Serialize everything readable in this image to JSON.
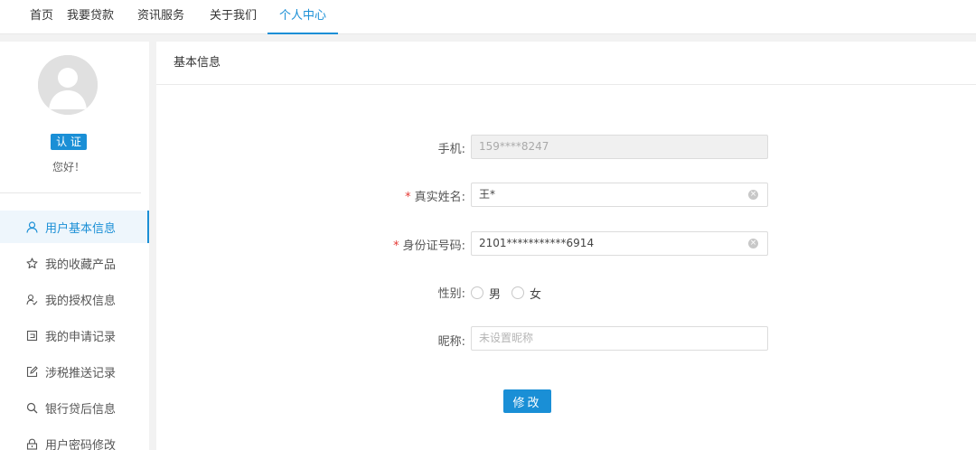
{
  "nav": {
    "items": [
      "首页",
      "我要贷款",
      "资讯服务",
      "关于我们",
      "个人中心"
    ],
    "active_index": 4
  },
  "sidebar": {
    "badge": "认 证",
    "greeting": "您好！",
    "menu": [
      {
        "label": "用户基本信息",
        "icon": "user-icon"
      },
      {
        "label": "我的收藏产品",
        "icon": "star-icon"
      },
      {
        "label": "我的授权信息",
        "icon": "authorize-icon"
      },
      {
        "label": "我的申请记录",
        "icon": "record-icon"
      },
      {
        "label": "涉税推送记录",
        "icon": "edit-icon"
      },
      {
        "label": "银行贷后信息",
        "icon": "search-icon"
      },
      {
        "label": "用户密码修改",
        "icon": "lock-icon"
      }
    ],
    "active_index": 0
  },
  "panel": {
    "title": "基本信息"
  },
  "form": {
    "phone_label": "手机:",
    "phone_value": "159****8247",
    "required_mark": "*",
    "name_label": "真实姓名:",
    "name_value": "王*",
    "id_label": "身份证号码:",
    "id_value": "2101***********6914",
    "gender_label": "性别:",
    "gender_options": [
      "男",
      "女"
    ],
    "nickname_label": "昵称:",
    "nickname_placeholder": "未设置昵称",
    "submit_label": "修改"
  },
  "colors": {
    "accent": "#1a8fd6",
    "required": "#e53935"
  }
}
